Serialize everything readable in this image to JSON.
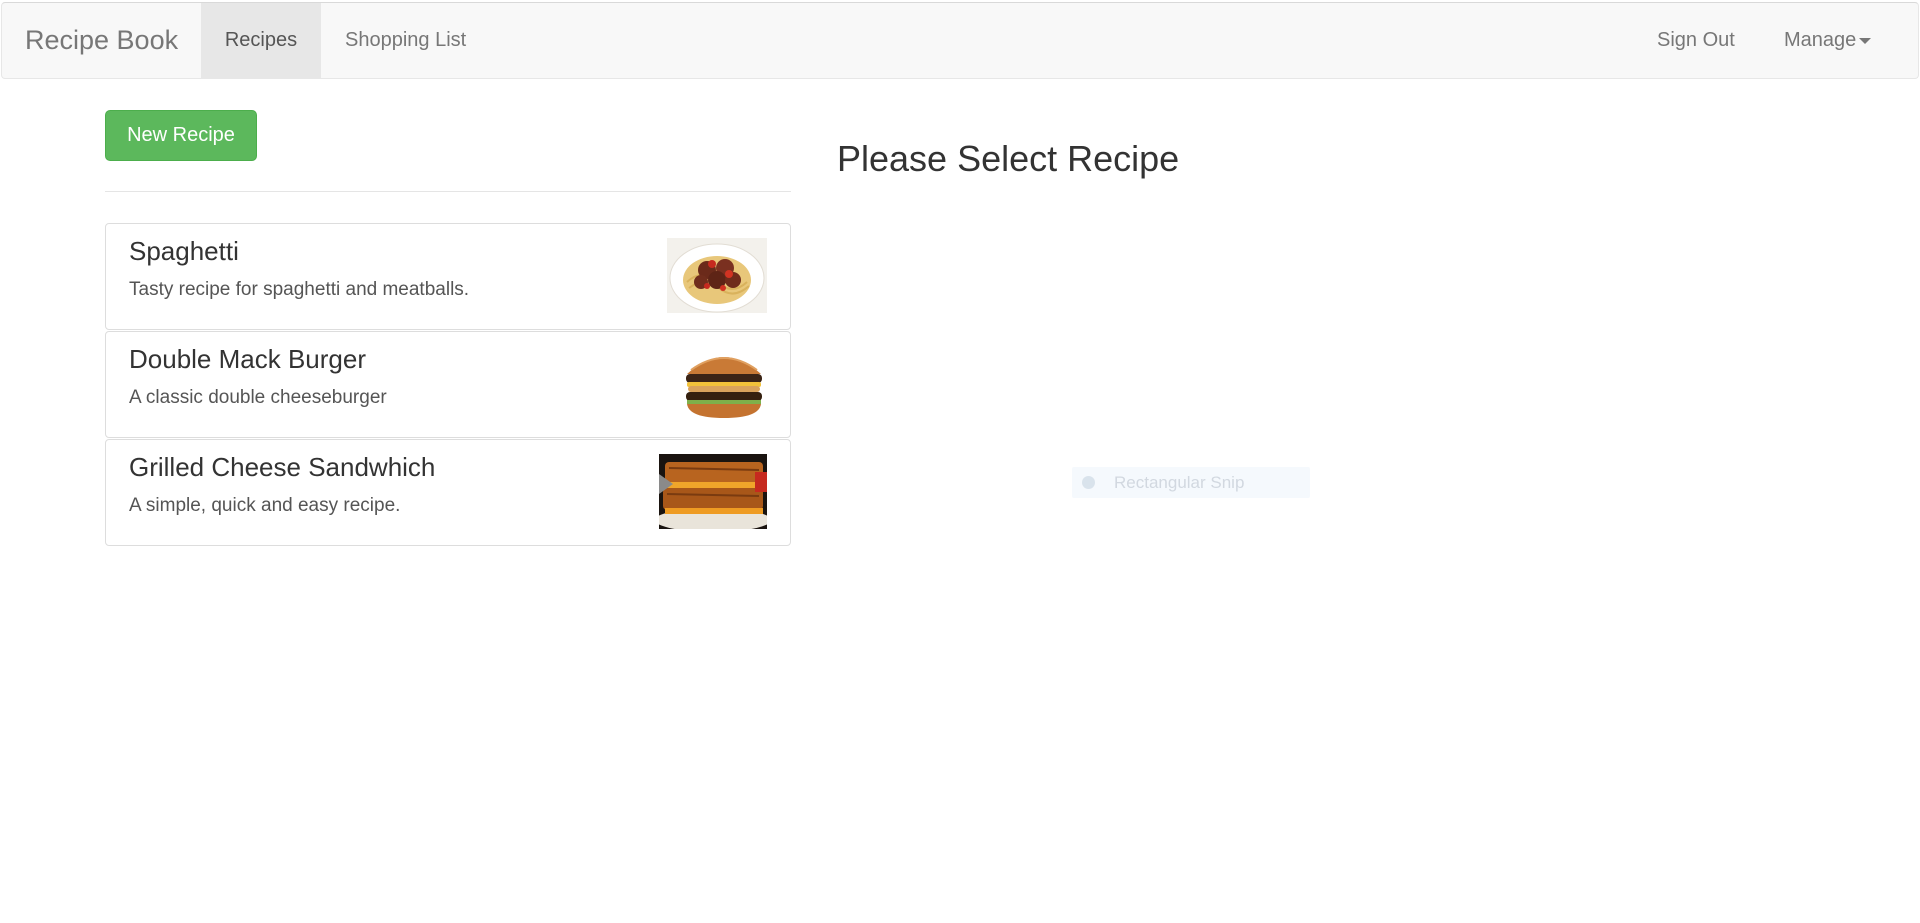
{
  "navbar": {
    "brand": "Recipe Book",
    "items": [
      {
        "label": "Recipes",
        "active": true
      },
      {
        "label": "Shopping List",
        "active": false
      }
    ],
    "right_items": [
      {
        "label": "Sign Out"
      },
      {
        "label": "Manage",
        "icon": "caret-down-icon"
      }
    ]
  },
  "sidebar": {
    "new_button_label": "New Recipe",
    "recipes": [
      {
        "name": "Spaghetti",
        "description": "Tasty recipe for spaghetti and meatballs.",
        "image": "spaghetti-photo"
      },
      {
        "name": "Double Mack Burger",
        "description": "A classic double cheeseburger",
        "image": "burger-photo"
      },
      {
        "name": "Grilled Cheese Sandwhich",
        "description": "A simple, quick and easy recipe.",
        "image": "grilled-cheese-photo"
      }
    ]
  },
  "detail": {
    "heading": "Please Select Recipe"
  },
  "overlay": {
    "label": "Rectangular Snip"
  },
  "colors": {
    "navbar_bg": "#f8f8f8",
    "active_tab_bg": "#e7e7e7",
    "success_button": "#5cb85c"
  }
}
